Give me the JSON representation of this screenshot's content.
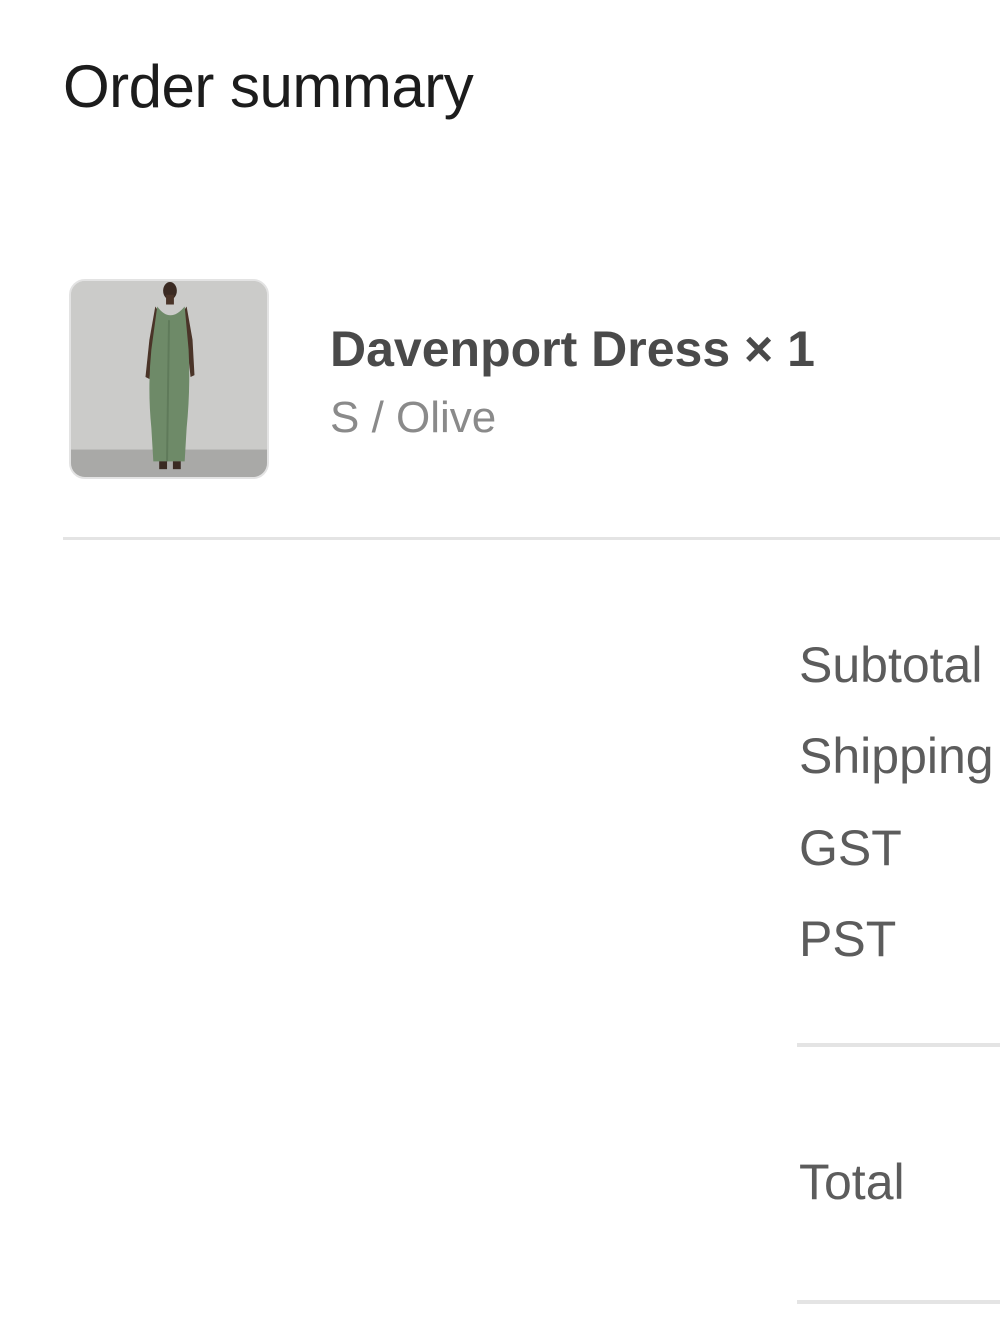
{
  "order_summary": {
    "title": "Order summary"
  },
  "line_item": {
    "image_alt": "Davenport Dress",
    "name": "Davenport Dress × 1",
    "variant": "S / Olive"
  },
  "totals": {
    "subtotal_label": "Subtotal",
    "shipping_label": "Shipping",
    "gst_label": "GST",
    "pst_label": "PST",
    "total_label": "Total"
  },
  "colors": {
    "text_primary": "#1c1c1c",
    "text_secondary": "#8a8a8a",
    "divider": "#e4e4e4",
    "dress_olive": "#6e8a68"
  }
}
